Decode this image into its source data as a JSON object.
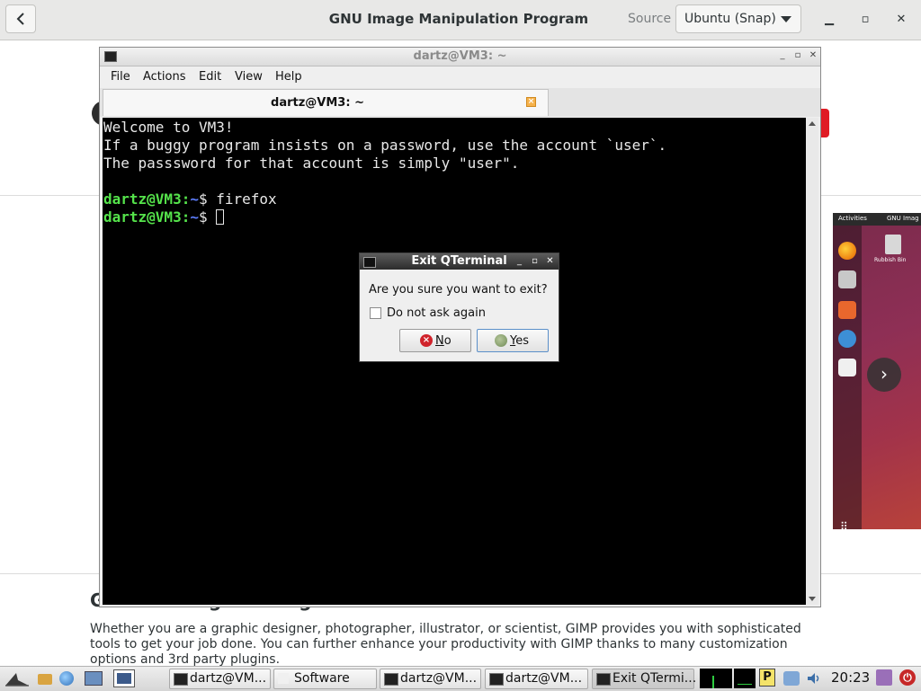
{
  "software_window": {
    "title": "GNU Image Manipulation Program",
    "source_label": "Source",
    "source_value": "Ubuntu (Snap)",
    "window_buttons": {
      "minimize": "▁",
      "maximize": "▫",
      "close": "✕"
    },
    "screenshot": {
      "activities": "Activities",
      "app_label": "GNU Imag",
      "trash_label": "Rubbish Bin"
    },
    "description_title": "Get the image editing",
    "description": "Whether you are a graphic designer, photographer, illustrator, or scientist, GIMP provides you with sophisticated tools to get your job done. You can further enhance your productivity with GIMP thanks to many customization options and 3rd party plugins."
  },
  "terminal_window": {
    "title": "dartz@VM3: ~",
    "menu": [
      "File",
      "Actions",
      "Edit",
      "View",
      "Help"
    ],
    "tab_label": "dartz@VM3: ~",
    "lines": [
      "Welcome to VM3!",
      "If a buggy program insists on a password, use the account `user`.",
      "The passsword for that account is simply \"user\"."
    ],
    "prompts": [
      {
        "user": "dartz@VM3",
        "sep": ":",
        "path": "~",
        "dollar": "$ ",
        "command": "firefox"
      },
      {
        "user": "dartz@VM3",
        "sep": ":",
        "path": "~",
        "dollar": "$ ",
        "command": ""
      }
    ]
  },
  "exit_dialog": {
    "title": "Exit QTerminal",
    "message": "Are you sure you want to exit?",
    "checkbox_label": "Do not ask again",
    "checkbox_checked": false,
    "no_button": {
      "mnemonic": "N",
      "rest": "o"
    },
    "yes_button": {
      "mnemonic": "Y",
      "rest": "es"
    }
  },
  "taskbar": {
    "tasks": [
      "dartz@VM...",
      "Software",
      "dartz@VM...",
      "dartz@VM...",
      "Exit QTermi..."
    ],
    "pager_label": "P",
    "clock": "20:23"
  }
}
